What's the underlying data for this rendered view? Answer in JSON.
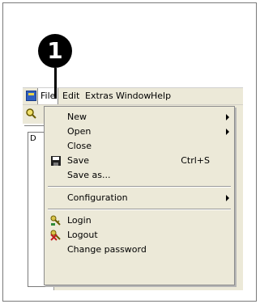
{
  "callout": {
    "number": "1"
  },
  "menubar": {
    "items": [
      "File",
      "Edit",
      "Extras",
      "Window",
      "Help"
    ]
  },
  "file_menu": {
    "items": [
      {
        "label": "New",
        "submenu": true
      },
      {
        "label": "Open",
        "submenu": true
      },
      {
        "label": "Close"
      },
      {
        "label": "Save",
        "shortcut": "Ctrl+S",
        "icon": "floppy-disk-icon"
      },
      {
        "label": "Save as..."
      },
      {
        "label": "Configuration",
        "submenu": true
      },
      {
        "label": "Login",
        "icon": "key-login-icon"
      },
      {
        "label": "Logout",
        "icon": "key-logout-icon"
      },
      {
        "label": "Change password"
      }
    ]
  },
  "left_panel": {
    "title": "D"
  },
  "colors": {
    "menu_bg": "#ece9d8",
    "callout": "#000000"
  }
}
